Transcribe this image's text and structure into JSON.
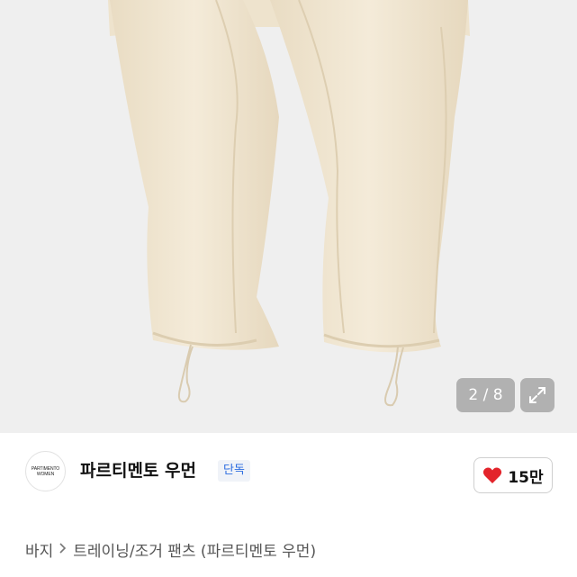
{
  "gallery": {
    "counter": "2 / 8",
    "background": "#efefef",
    "fabric_color": "#f1e7d3"
  },
  "brand": {
    "logo_line1": "PARTIMENTO",
    "logo_line2": "WOMEN",
    "name": "파르티멘토 우먼",
    "badge": "단독",
    "badge_color": "#2b6ce0"
  },
  "like": {
    "icon": "heart-icon",
    "count": "15만",
    "color": "#e3242b"
  },
  "breadcrumb": {
    "root": "바지",
    "separator_icon": "chevron-right-icon",
    "category": "트레이닝/조거 팬츠 (파르티멘토 우먼)"
  }
}
